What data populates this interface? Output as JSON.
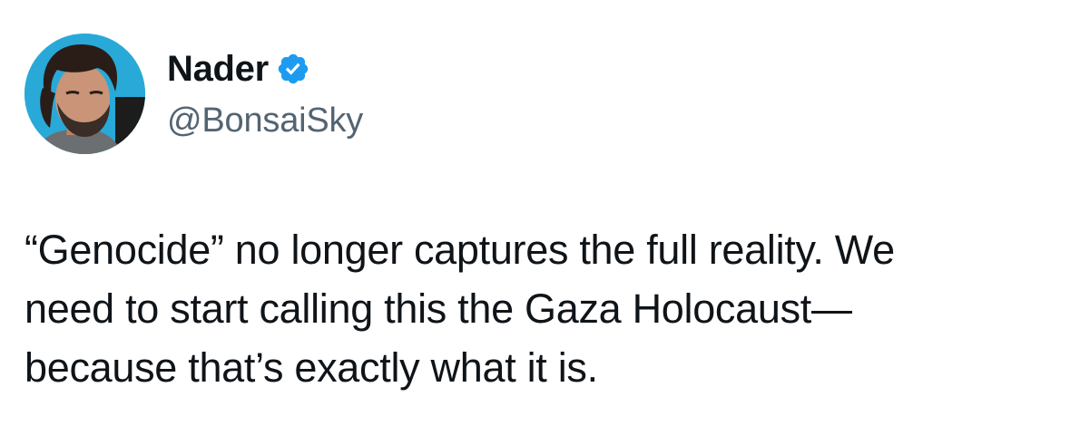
{
  "author": {
    "display_name": "Nader",
    "handle": "@BonsaiSky",
    "verified": true,
    "avatar_icon": "profile-photo",
    "verified_icon": "verified-badge-icon"
  },
  "tweet": {
    "text": "“Genocide” no longer captures the full reality. We\nneed to start calling this the Gaza Holocaust—\nbecause that’s exactly what it is."
  },
  "colors": {
    "text_primary": "#0f1419",
    "text_secondary": "#536471",
    "verified_blue": "#1d9bf0",
    "avatar_background": "#29a9d8"
  }
}
